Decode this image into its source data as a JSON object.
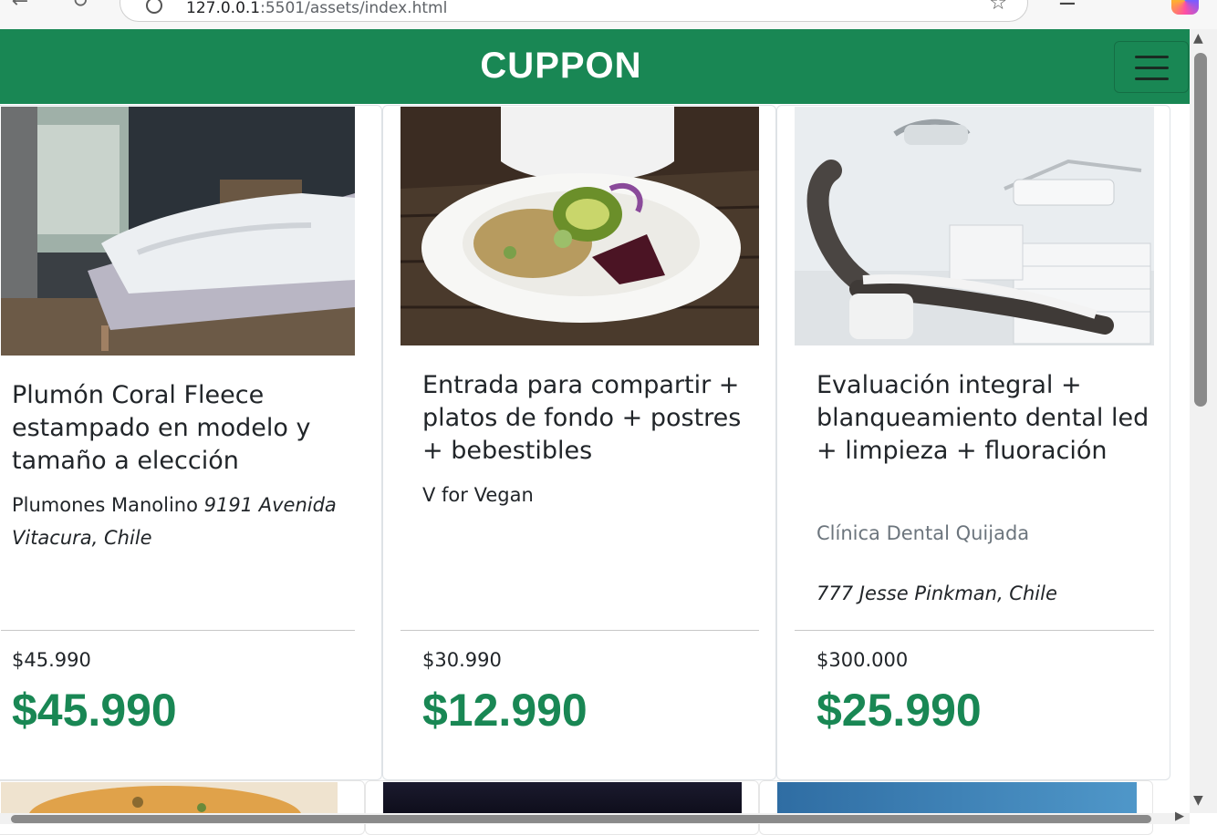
{
  "browser": {
    "url_host": "127.0.0.1",
    "url_rest": ":5501/assets/index.html"
  },
  "navbar": {
    "brand": "CUPPON",
    "toggler_icon": "hamburger-menu-icon"
  },
  "colors": {
    "brand_green": "#198754",
    "text_dark": "#212529",
    "muted": "#6c757d"
  },
  "cards": [
    {
      "image": "bedroom-bed-photo",
      "title": "Plumón Coral Fleece estampado en modelo y tamaño a elección",
      "merchant": "Plumones Manolino",
      "address": "9191 Avenida Vitacura, Chile",
      "old_price": "$45.990",
      "new_price": "$45.990"
    },
    {
      "image": "vegan-salad-plate-photo",
      "title": "Entrada para compartir + platos de fondo + postres + bebestibles",
      "merchant": "V for Vegan",
      "address": "",
      "old_price": "$30.990",
      "new_price": "$12.990"
    },
    {
      "image": "dental-chair-photo",
      "title": "Evaluación integral + blanqueamiento dental led + limpieza + fluoración",
      "merchant": "Clínica Dental Quijada",
      "address": "777 Jesse Pinkman, Chile",
      "old_price": "$300.000",
      "new_price": "$25.990"
    }
  ]
}
